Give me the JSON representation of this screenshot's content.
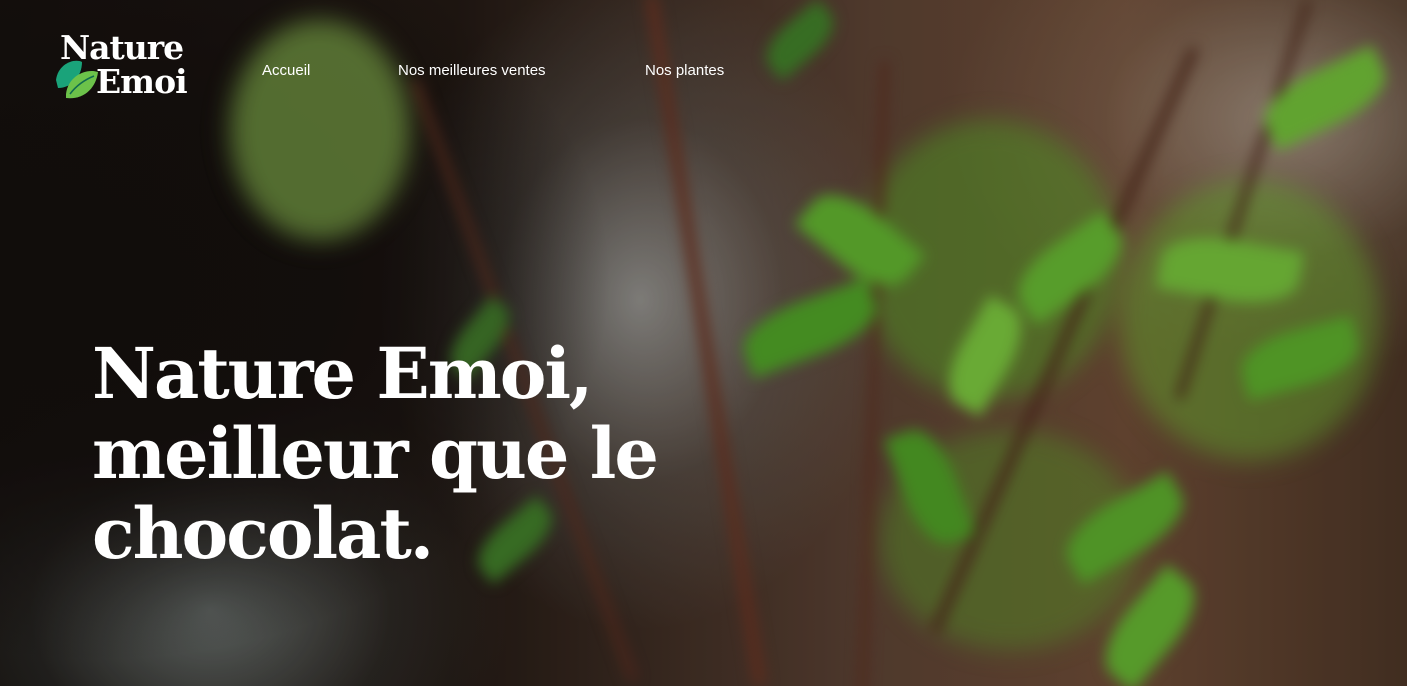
{
  "brand": {
    "logo_line1": "Nature",
    "logo_line2": "Emoi",
    "leaf_colors": [
      "#1aa37a",
      "#6cc24a"
    ]
  },
  "nav": {
    "items": [
      {
        "label": "Accueil"
      },
      {
        "label": "Nos meilleures ventes"
      },
      {
        "label": "Nos plantes"
      }
    ]
  },
  "hero": {
    "headline_lines": [
      "Nature Emoi,",
      "meilleur que le",
      "chocolat."
    ],
    "text_color": "#ffffff"
  }
}
